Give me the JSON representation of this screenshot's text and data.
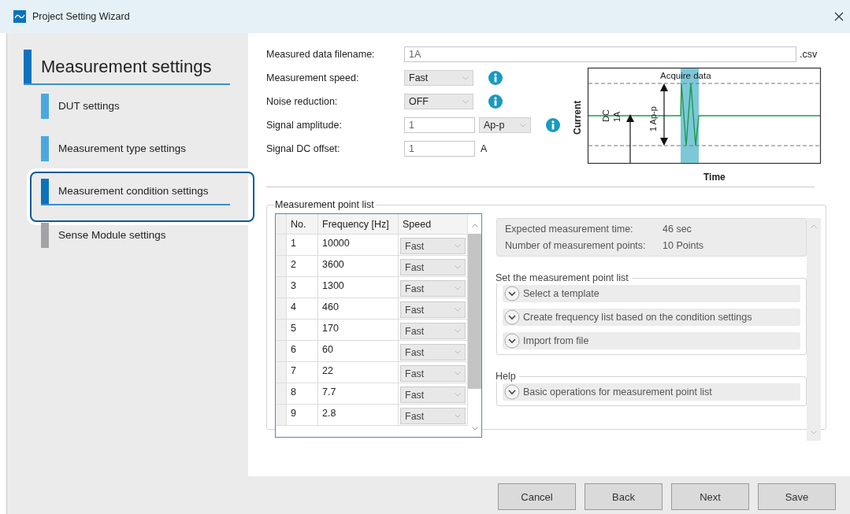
{
  "window": {
    "title": "Project Setting Wizard"
  },
  "sidebar": {
    "heading": "Measurement settings",
    "items": [
      {
        "label": "DUT settings",
        "selected": false,
        "enabled": true
      },
      {
        "label": "Measurement type settings",
        "selected": false,
        "enabled": true
      },
      {
        "label": "Measurement condition settings",
        "selected": true,
        "enabled": true
      },
      {
        "label": "Sense Module settings",
        "selected": false,
        "enabled": false
      }
    ]
  },
  "form": {
    "fields": [
      {
        "kind": "text",
        "label": "Measured data filename:",
        "value": "1A",
        "suffix": ".csv",
        "info": false
      },
      {
        "kind": "select",
        "label": "Measurement speed:",
        "value": "Fast",
        "info": true
      },
      {
        "kind": "select",
        "label": "Noise reduction:",
        "value": "OFF",
        "info": true
      },
      {
        "kind": "number_select",
        "label": "Signal amplitude:",
        "value": "1",
        "unit": "Ap-p",
        "info": true
      },
      {
        "kind": "number_unit",
        "label": "Signal DC offset:",
        "value": "1",
        "unit": "A",
        "info": false
      }
    ]
  },
  "diagram": {
    "title": "Acquire data",
    "ylabel": "Current",
    "xlabel": "Time",
    "dc_label": "DC",
    "dc_value": "1A",
    "amplitude_label": "1 Ap-p"
  },
  "point_list": {
    "title": "Measurement point list",
    "columns": [
      "No.",
      "Frequency [Hz]",
      "Speed"
    ],
    "rows": [
      {
        "no": "1",
        "frequency": "10000",
        "speed": "Fast"
      },
      {
        "no": "2",
        "frequency": "3600",
        "speed": "Fast"
      },
      {
        "no": "3",
        "frequency": "1300",
        "speed": "Fast"
      },
      {
        "no": "4",
        "frequency": "460",
        "speed": "Fast"
      },
      {
        "no": "5",
        "frequency": "170",
        "speed": "Fast"
      },
      {
        "no": "6",
        "frequency": "60",
        "speed": "Fast"
      },
      {
        "no": "7",
        "frequency": "22",
        "speed": "Fast"
      },
      {
        "no": "8",
        "frequency": "7.7",
        "speed": "Fast"
      },
      {
        "no": "9",
        "frequency": "2.8",
        "speed": "Fast"
      }
    ]
  },
  "summary": [
    {
      "label": "Expected measurement time:",
      "value": "46 sec"
    },
    {
      "label": "Number of measurement points:",
      "value": "10 Points"
    }
  ],
  "sections": [
    {
      "title": "Set the measurement point list",
      "items": [
        {
          "label": "Select a template",
          "expanded": false
        },
        {
          "label": "Create frequency list based on the condition settings",
          "expanded": false
        },
        {
          "label": "Import from file",
          "expanded": false
        }
      ]
    },
    {
      "title": "Help",
      "items": [
        {
          "label": "Basic operations for measurement point list",
          "expanded": false
        }
      ]
    }
  ],
  "buttons": [
    "Cancel",
    "Back",
    "Next",
    "Save"
  ]
}
